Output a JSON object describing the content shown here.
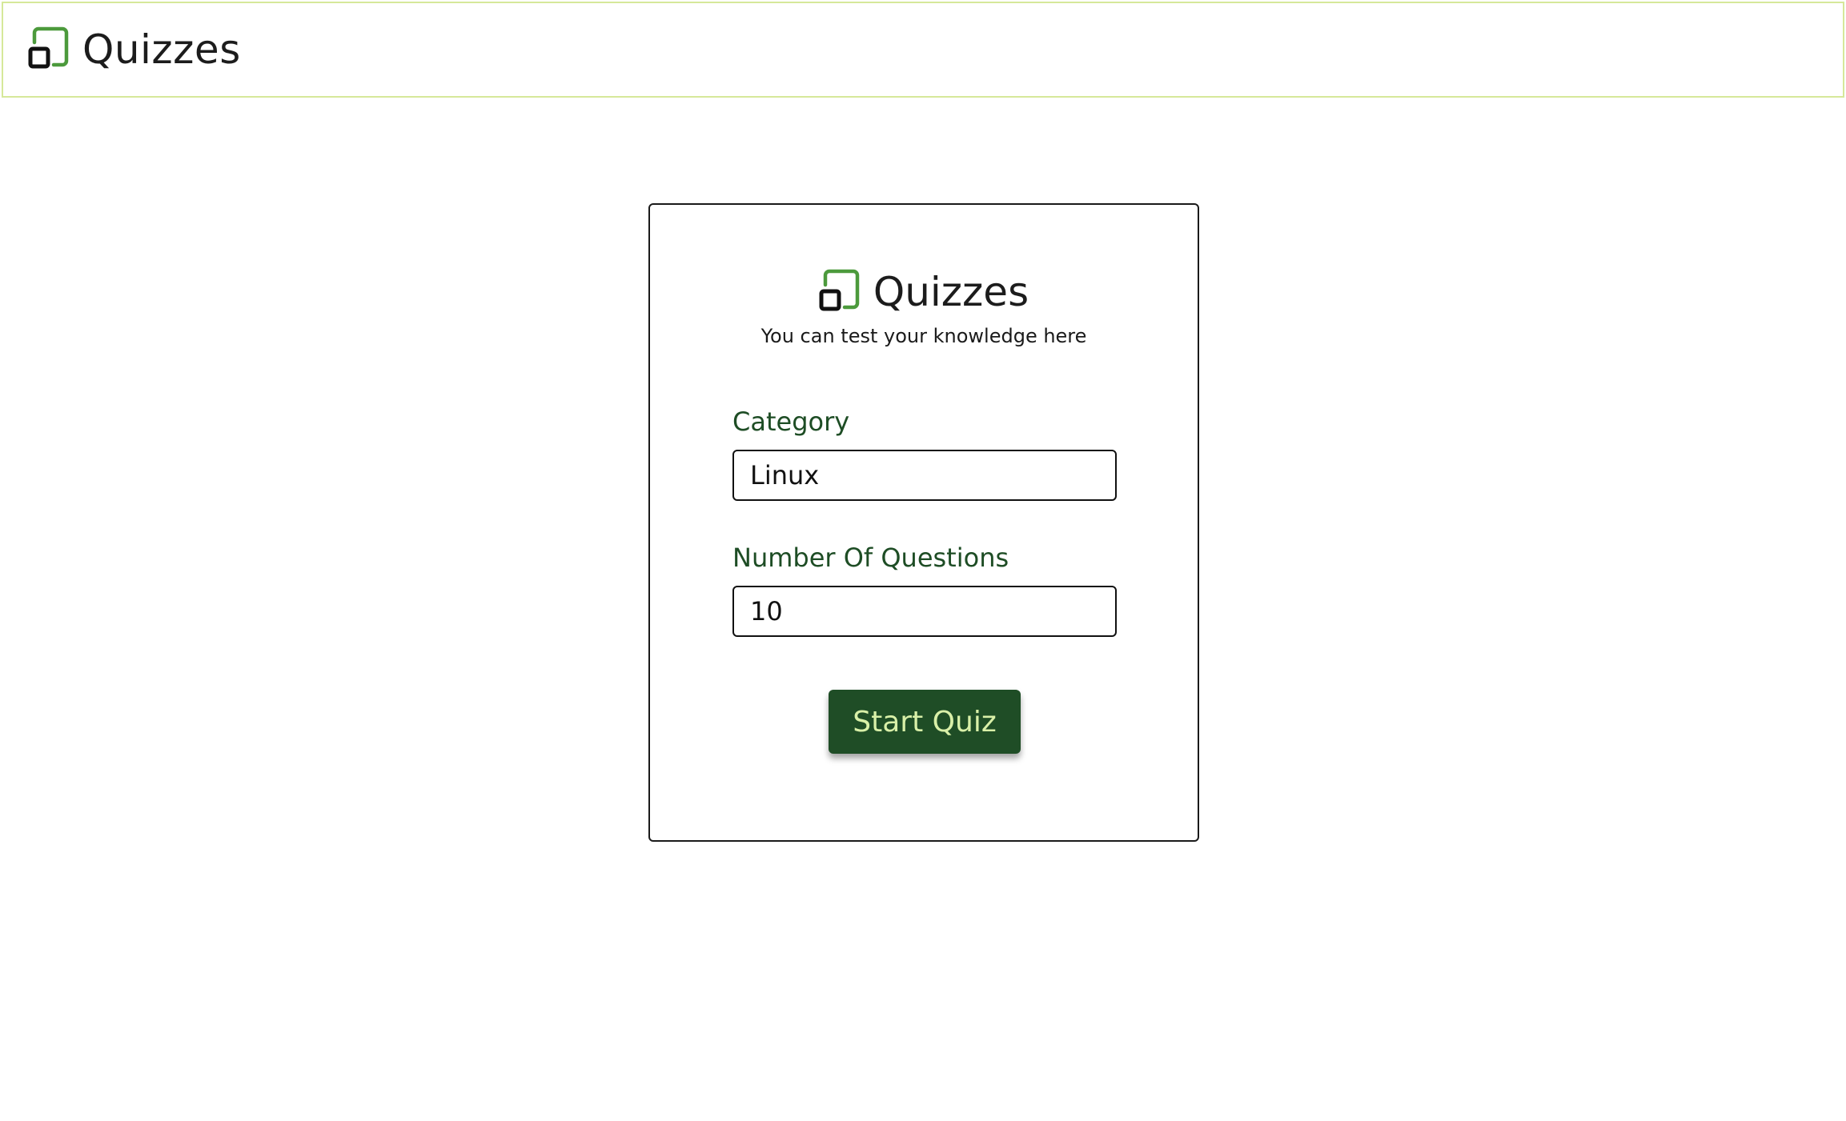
{
  "navbar": {
    "brand_name": "Quizzes",
    "logo_icon": "quizzes-logo-icon"
  },
  "card": {
    "brand_name": "Quizzes",
    "subtitle": "You can test your knowledge here",
    "category": {
      "label": "Category",
      "value": "Linux"
    },
    "questions": {
      "label": "Number Of Questions",
      "value": "10"
    },
    "start_label": "Start Quiz"
  },
  "colors": {
    "accent_green": "#1f4d26",
    "logo_green": "#4c9a3c",
    "label_green": "#1e4d25",
    "button_text": "#d9f0a8",
    "navbar_border": "#d6e89a"
  }
}
